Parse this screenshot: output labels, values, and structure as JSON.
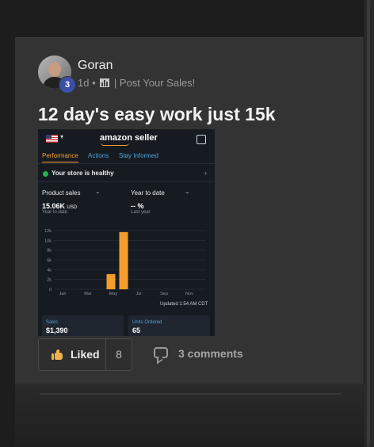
{
  "post": {
    "author": "Goran",
    "level_badge": "3",
    "age": "1d",
    "separator": "•",
    "group": "| Post Your Sales!",
    "title": "12 day's easy work just 15k",
    "actions": {
      "liked_label": "Liked",
      "like_count": "8",
      "comments_label": "3 comments"
    }
  },
  "screenshot": {
    "logo": "amazon seller",
    "tabs": [
      "Performance",
      "Actions",
      "Stay Informed"
    ],
    "health": "Your store is healthy",
    "left_select": "Product sales",
    "right_select": "Year to date",
    "left_value": "15.06K",
    "left_unit": "USD",
    "left_sub": "Year to date",
    "right_value": "-- %",
    "right_sub": "Last year",
    "updated": "Updated 1:54 AM CDT",
    "box1_label": "Sales",
    "box1_value": "$1,390",
    "box2_label": "Units Ordered",
    "box2_value": "65",
    "colors": {
      "accent": "#f59d2a",
      "link": "#4ea1d8",
      "healthy": "#2bb24c"
    },
    "chart_data": {
      "type": "bar",
      "categories": [
        "Jan",
        "Feb",
        "Mar",
        "Apr",
        "May",
        "Jun",
        "Jul",
        "Aug",
        "Sep",
        "Oct",
        "Nov",
        "Dec"
      ],
      "x_tick_labels": [
        "Jan",
        "Mar",
        "May",
        "Jul",
        "Sep",
        "Nov"
      ],
      "values": [
        0,
        0,
        0,
        0,
        3100,
        11700,
        0,
        0,
        0,
        0,
        0,
        0
      ],
      "y_tick_labels": [
        "0",
        "2k",
        "4k",
        "6k",
        "8k",
        "10k",
        "12k"
      ],
      "ylim": [
        0,
        12000
      ],
      "grid": true,
      "bar_color": "#f59d2a"
    }
  }
}
